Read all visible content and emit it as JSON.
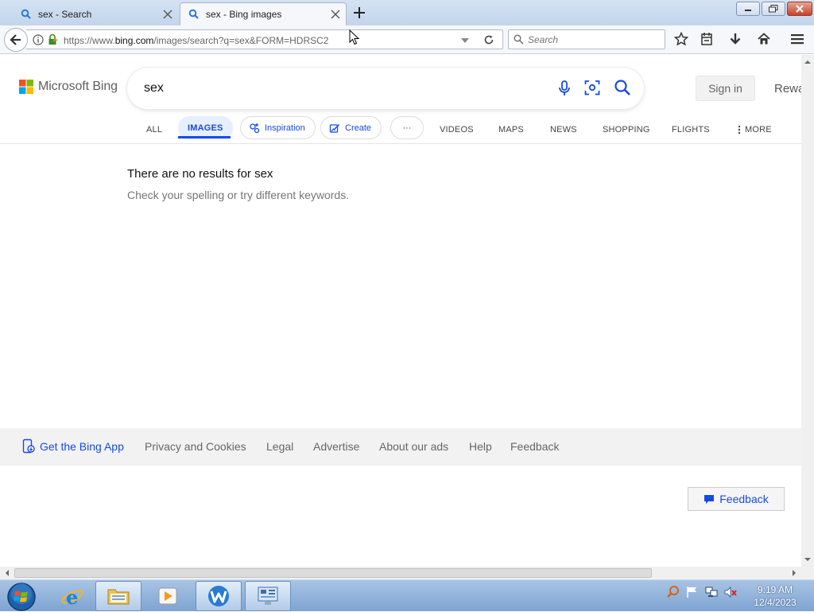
{
  "browser": {
    "tabs": [
      {
        "title": "sex - Search",
        "active": false
      },
      {
        "title": "sex - Bing images",
        "active": true
      }
    ],
    "url": {
      "prefix": "https://www.",
      "host": "bing.com",
      "path": "/images/search?q=sex&FORM=HDRSC2"
    },
    "search_placeholder": "Search"
  },
  "bing": {
    "brand": "Microsoft Bing",
    "query": "sex",
    "sign_in": "Sign in",
    "rewards": "Rewa",
    "nav": {
      "all": "ALL",
      "images": "IMAGES",
      "inspiration": "Inspiration",
      "create": "Create",
      "more_dots": "···",
      "videos": "VIDEOS",
      "maps": "MAPS",
      "news": "NEWS",
      "shopping": "SHOPPING",
      "flights": "FLIGHTS",
      "more": "MORE"
    },
    "no_results_title": "There are no results for sex",
    "no_results_hint": "Check your spelling or try different keywords.",
    "footer": {
      "app": "Get the Bing App",
      "privacy": "Privacy and Cookies",
      "legal": "Legal",
      "advertise": "Advertise",
      "about_ads": "About our ads",
      "help": "Help",
      "feedback": "Feedback"
    },
    "feedback_button": "Feedback",
    "accent_color": "#174ae4"
  },
  "taskbar": {
    "time": "9:19 AM",
    "date": "12/4/2023"
  }
}
